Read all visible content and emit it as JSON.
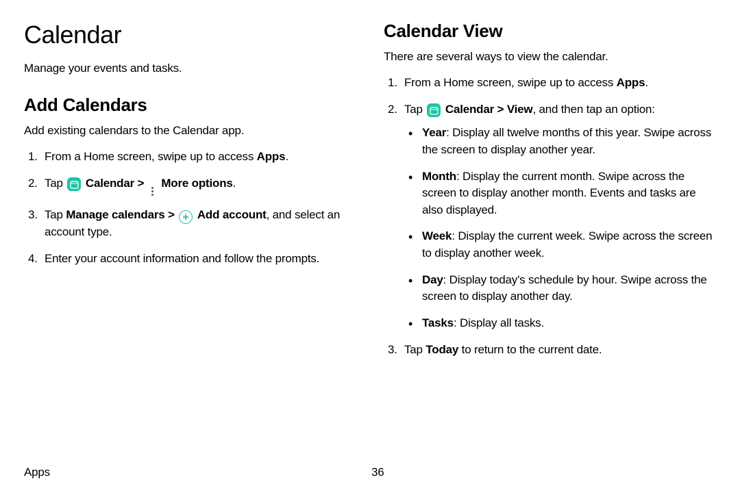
{
  "left": {
    "title": "Calendar",
    "subtitle": "Manage your events and tasks.",
    "section_title": "Add Calendars",
    "intro": "Add existing calendars to the Calendar app.",
    "steps": {
      "s1_a": "From a Home screen, swipe up to access ",
      "s1_b": "Apps",
      "s1_c": ".",
      "s2_a": "Tap ",
      "s2_b": "Calendar",
      "s2_c": " > ",
      "s2_d": "More options",
      "s2_e": ".",
      "s3_a": "Tap ",
      "s3_b": "Manage calendars",
      "s3_c": " > ",
      "s3_d": "Add account",
      "s3_e": ", and select an account type.",
      "s4": "Enter your account information and follow the prompts."
    }
  },
  "right": {
    "section_title": "Calendar View",
    "intro": "There are several ways to view the calendar.",
    "steps": {
      "s1_a": "From a Home screen, swipe up to access ",
      "s1_b": "Apps",
      "s1_c": ".",
      "s2_a": "Tap ",
      "s2_b": "Calendar",
      "s2_c": " > ",
      "s2_d": "View",
      "s2_e": ", and then tap an option:",
      "s3_a": "Tap ",
      "s3_b": "Today",
      "s3_c": " to return to the current date."
    },
    "options": {
      "year_b": "Year",
      "year_t": ": Display all twelve months of this year. Swipe across the screen to display another year.",
      "month_b": "Month",
      "month_t": ": Display the current month. Swipe across the screen to display another month. Events and tasks are also displayed.",
      "week_b": "Week",
      "week_t": ": Display the current week. Swipe across the screen to display another week.",
      "day_b": "Day",
      "day_t": ": Display today's schedule by hour. Swipe across the screen to display another day.",
      "tasks_b": "Tasks",
      "tasks_t": ": Display all tasks."
    }
  },
  "footer": {
    "section": "Apps",
    "page": "36"
  }
}
